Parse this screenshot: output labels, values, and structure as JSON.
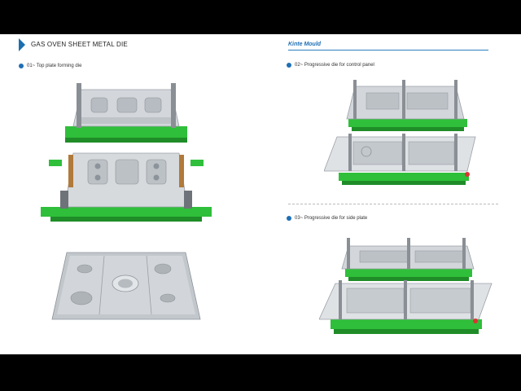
{
  "document": {
    "title": "GAS OVEN SHEET METAL DIE",
    "brand": "Kinte Mould"
  },
  "sections": [
    {
      "number": "01",
      "caption": "01~ Top plate forming die"
    },
    {
      "number": "02",
      "caption": "02~ Progressive die for control panel"
    },
    {
      "number": "03",
      "caption": "03~ Progressive die for side plate"
    }
  ],
  "colors": {
    "accent": "#1e6fb5",
    "die_green": "#2fbf3a",
    "steel": "#c9ced3"
  }
}
